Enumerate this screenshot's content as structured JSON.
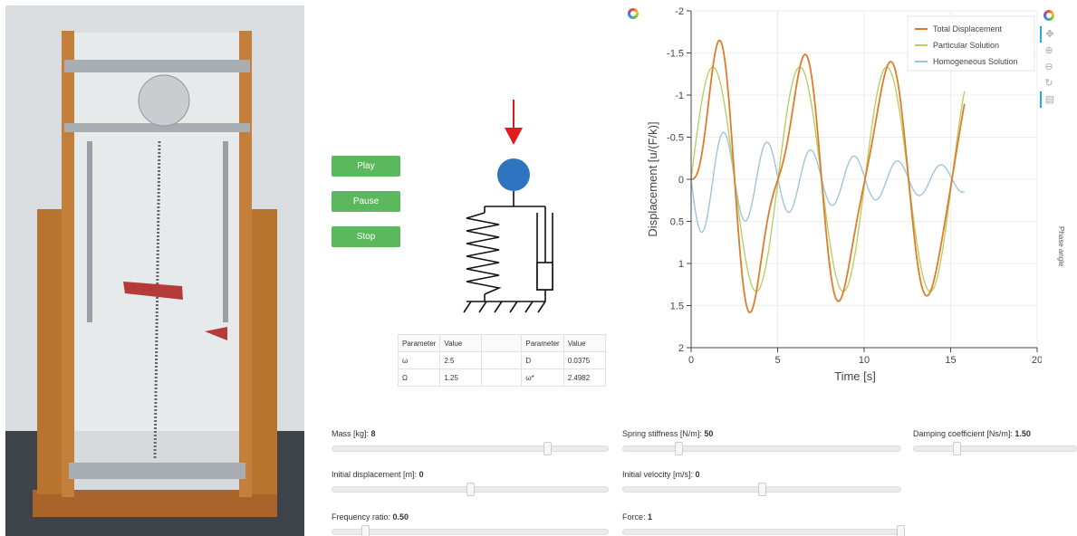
{
  "controls": {
    "play_label": "Play",
    "pause_label": "Pause",
    "stop_label": "Stop"
  },
  "table": {
    "headers": [
      "Parameter",
      "Value",
      "",
      "Parameter",
      "Value"
    ],
    "rows": [
      [
        "ω",
        "2.5",
        "",
        "D",
        "0.0375"
      ],
      [
        "Ω",
        "1.25",
        "",
        "ω*",
        "2.4982"
      ]
    ]
  },
  "sliders": [
    {
      "label": "Mass [kg]:",
      "value": "8",
      "fraction": 0.78
    },
    {
      "label": "Spring stiffness [N/m]:",
      "value": "50",
      "fraction": 0.2
    },
    {
      "label": "Damping coefficient [Ns/m]:",
      "value": "1.50",
      "fraction": 0.26
    },
    {
      "label": "Initial displacement [m]:",
      "value": "0",
      "fraction": 0.5
    },
    {
      "label": "Initial velocity [m/s]:",
      "value": "0",
      "fraction": 0.5
    },
    {
      "label": "Frequency ratio:",
      "value": "0.50",
      "fraction": 0.12
    },
    {
      "label": "Force:",
      "value": "1",
      "fraction": 1.0
    }
  ],
  "side_label": "Phase angle",
  "chart_data": {
    "type": "line",
    "xlabel": "Time [s]",
    "ylabel": "Displacement [u/(F/k)]",
    "xlim": [
      0,
      20
    ],
    "ylim": [
      -2,
      2
    ],
    "y_inverted": true,
    "xticks": [
      "0",
      "5",
      "10",
      "15",
      "20"
    ],
    "yticks": [
      "-2",
      "-1.5",
      "-1",
      "-0.5",
      "0",
      "0.5",
      "1",
      "1.5",
      "2"
    ],
    "grid": true,
    "legend": "top-right",
    "series": [
      {
        "name": "Total Displacement",
        "color": "#e07b2a"
      },
      {
        "name": "Particular Solution",
        "color": "#b5d166"
      },
      {
        "name": "Homogeneous Solution",
        "color": "#9fc5d8"
      }
    ],
    "params": {
      "amplitude": 1.333,
      "omega_forced": 1.25,
      "omega_natural": 2.5,
      "damping_ratio": 0.0375,
      "duration": 15.8
    }
  }
}
